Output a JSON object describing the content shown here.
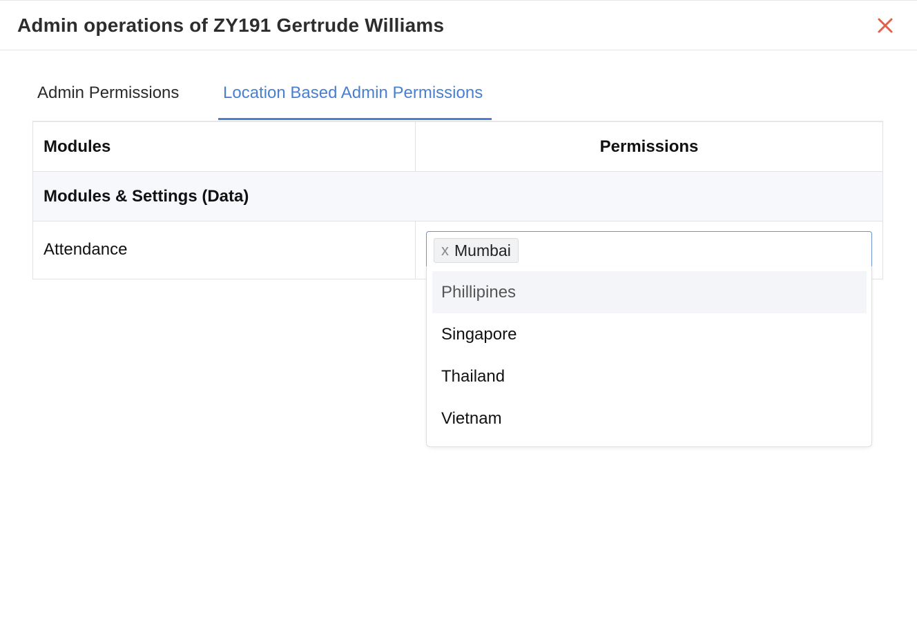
{
  "dialog": {
    "title": "Admin operations of ZY191 Gertrude Williams",
    "close_icon": "close-icon",
    "close_color": "#e0604c"
  },
  "tabs": [
    {
      "label": "Admin Permissions",
      "active": false
    },
    {
      "label": "Location Based Admin Permissions",
      "active": true
    }
  ],
  "accent_color": "#4a7fcf",
  "table": {
    "headers": {
      "modules": "Modules",
      "permissions": "Permissions"
    },
    "section": "Modules & Settings (Data)",
    "rows": [
      {
        "module": "Attendance"
      }
    ]
  },
  "multiselect": {
    "selected": [
      {
        "label": "Mumbai",
        "remove": "x"
      }
    ],
    "options": [
      {
        "label": "Phillipines",
        "highlighted": true
      },
      {
        "label": "Singapore",
        "highlighted": false
      },
      {
        "label": "Thailand",
        "highlighted": false
      },
      {
        "label": "Vietnam",
        "highlighted": false
      }
    ]
  }
}
